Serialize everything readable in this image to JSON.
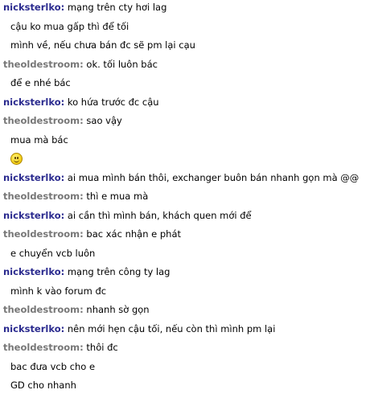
{
  "chat": {
    "messages": [
      {
        "sender": "nicksterlko",
        "role": "nick",
        "lines": [
          "mạng trên cty hơi lag",
          "cậu ko mua gấp thì để tối",
          "mình về, nếu chưa bán đc sẽ pm lại cạu"
        ]
      },
      {
        "sender": "theoldestroom",
        "role": "old",
        "lines": [
          "ok. tối luôn bác",
          "để e nhé bác"
        ]
      },
      {
        "sender": "nicksterlko",
        "role": "nick",
        "lines": [
          "ko hứa trước đc cậu"
        ]
      },
      {
        "sender": "theoldestroom",
        "role": "old",
        "lines": [
          "sao vậy",
          "mua mà bác"
        ],
        "emoji": "smiley-icon"
      },
      {
        "sender": "nicksterlko",
        "role": "nick",
        "lines": [
          "ai mua mình bán thôi, exchanger buôn bán nhanh gọn mà @@"
        ]
      },
      {
        "sender": "theoldestroom",
        "role": "old",
        "lines": [
          "thì e mua mà"
        ]
      },
      {
        "sender": "nicksterlko",
        "role": "nick",
        "lines": [
          "ai cần thì mình bán, khách quen mới để"
        ]
      },
      {
        "sender": "theoldestroom",
        "role": "old",
        "lines": [
          "bac xác nhận e phát",
          "e chuyển vcb luôn"
        ]
      },
      {
        "sender": "nicksterlko",
        "role": "nick",
        "lines": [
          "mạng trên công ty lag",
          "mình k vào forum đc"
        ]
      },
      {
        "sender": "theoldestroom",
        "role": "old",
        "lines": [
          "nhanh sờ gọn"
        ]
      },
      {
        "sender": "nicksterlko",
        "role": "nick",
        "lines": [
          "nên mới hẹn cậu tối, nếu còn thì mình pm lại"
        ]
      },
      {
        "sender": "theoldestroom",
        "role": "old",
        "lines": [
          "thôi đc",
          "bac đưa vcb cho e",
          "GD cho nhanh"
        ]
      }
    ]
  }
}
